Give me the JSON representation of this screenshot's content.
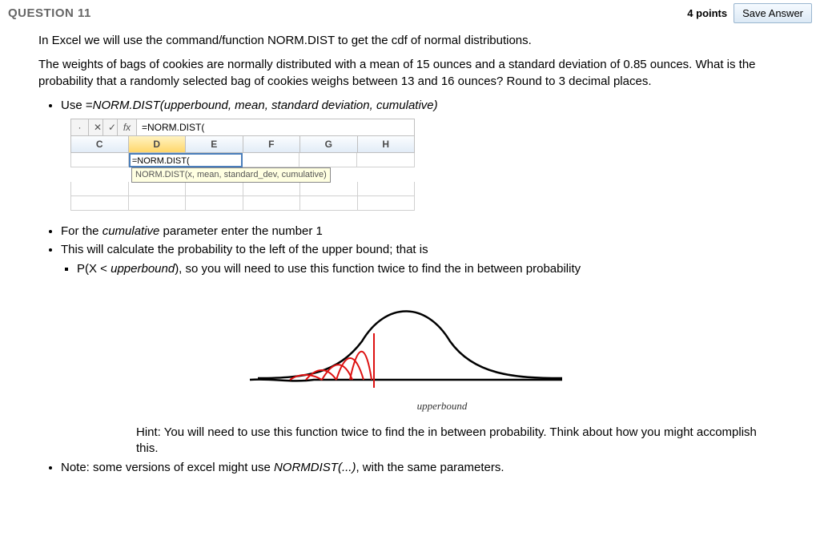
{
  "header": {
    "title": "QUESTION 11",
    "points": "4 points",
    "save_label": "Save Answer"
  },
  "body": {
    "intro": "In Excel we will use the command/function NORM.DIST to get the cdf of normal distributions.",
    "problem": "The weights of bags of cookies are normally distributed with a mean of 15 ounces and a standard deviation of 0.85 ounces. What is the probability that a randomly selected bag of cookies weighs between 13 and 16 ounces? Round to 3 decimal places.",
    "bullet_use_prefix": "Use =",
    "bullet_use_formula": "NORM.DIST(upperbound, mean, standard deviation, cumulative)",
    "bullet_cumulative_1": "For the ",
    "bullet_cumulative_word": "cumulative",
    "bullet_cumulative_2": " parameter enter the number 1",
    "bullet_leftprob": "This will calculate the probability to the left of the upper bound; that is",
    "sub_pxprefix": "P(X < ",
    "sub_upper": "upperbound",
    "sub_pxsuffix": "), so you will need to use this function twice to find the in between probability",
    "curve_label": "upperbound",
    "hint": "Hint: You will need to use this function twice to find the in between probability. Think about how you might accomplish this.",
    "note_prefix": "Note: some versions of excel might use ",
    "note_formula": "NORMDIST(...)",
    "note_suffix": ", with the same parameters."
  },
  "excel": {
    "fx_x": "✕",
    "fx_check": "✓",
    "fx_label": "fx",
    "fx_value": "=NORM.DIST(",
    "cols": [
      "C",
      "D",
      "E",
      "F",
      "G",
      "H"
    ],
    "cell_value": "=NORM.DIST(",
    "tooltip": "NORM.DIST(x, mean, standard_dev, cumulative)"
  }
}
